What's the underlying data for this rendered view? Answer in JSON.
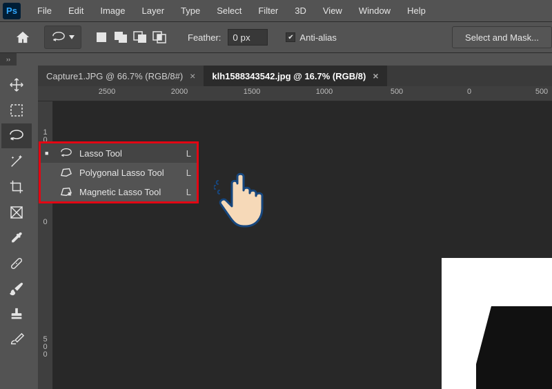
{
  "menubar": {
    "items": [
      "File",
      "Edit",
      "Image",
      "Layer",
      "Type",
      "Select",
      "Filter",
      "3D",
      "View",
      "Window",
      "Help"
    ]
  },
  "logo": "Ps",
  "optbar": {
    "feather_label": "Feather:",
    "feather_value": "0 px",
    "anti_alias_label": "Anti-alias",
    "select_mask": "Select and Mask..."
  },
  "tabs": [
    {
      "label": "Capture1.JPG @ 66.7% (RGB/8#)",
      "active": false
    },
    {
      "label": "klh1588343542.jpg @ 16.7% (RGB/8)",
      "active": true
    }
  ],
  "ruler": {
    "h": [
      "2500",
      "2000",
      "1500",
      "1000",
      "500",
      "0",
      "500"
    ],
    "v": [
      "1\n0\n0\n0",
      "0",
      "5\n0\n0"
    ]
  },
  "flyout": {
    "items": [
      {
        "label": "Lasso Tool",
        "shortcut": "L",
        "selected": true
      },
      {
        "label": "Polygonal Lasso Tool",
        "shortcut": "L",
        "selected": false
      },
      {
        "label": "Magnetic Lasso Tool",
        "shortcut": "L",
        "selected": false
      }
    ]
  },
  "panel_toggle": "››"
}
